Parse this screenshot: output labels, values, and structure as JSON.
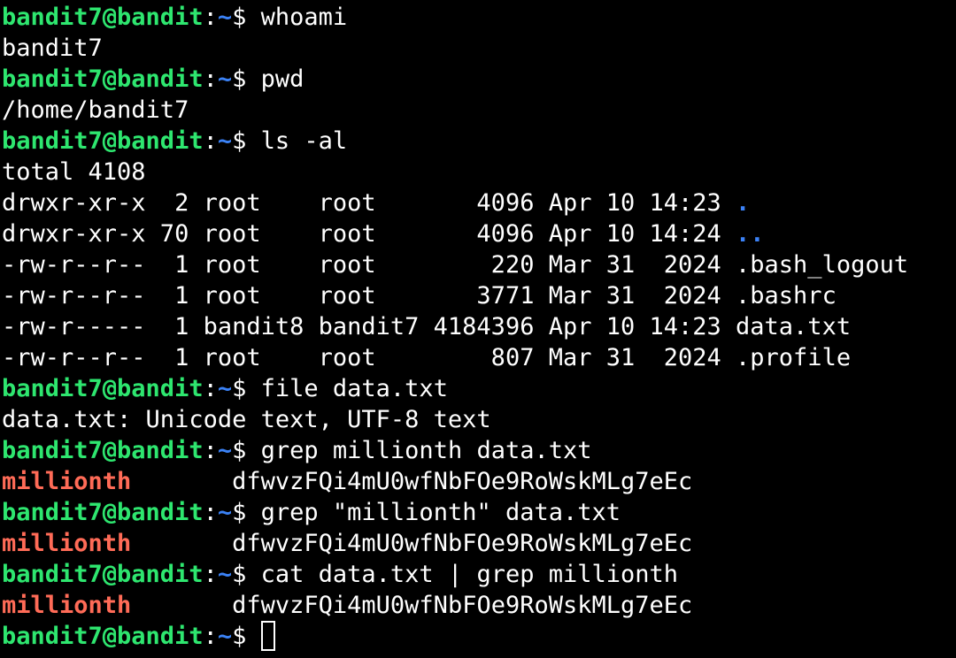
{
  "prompt": {
    "user_host": "bandit7@bandit",
    "colon": ":",
    "path": "~",
    "dollar": "$ "
  },
  "commands": {
    "whoami": "whoami",
    "pwd": "pwd",
    "ls": "ls -al",
    "file": "file data.txt",
    "grep1": "grep millionth data.txt",
    "grep2": "grep \"millionth\" data.txt",
    "cat": "cat data.txt | grep millionth"
  },
  "outputs": {
    "whoami": "bandit7",
    "pwd": "/home/bandit7",
    "total": "total 4108",
    "file": "data.txt: Unicode text, UTF-8 text"
  },
  "ls_rows": [
    {
      "meta": "drwxr-xr-x  2 root    root       4096 Apr 10 14:23 ",
      "name": ".",
      "is_dir": true
    },
    {
      "meta": "drwxr-xr-x 70 root    root       4096 Apr 10 14:24 ",
      "name": "..",
      "is_dir": true
    },
    {
      "meta": "-rw-r--r--  1 root    root        220 Mar 31  2024 ",
      "name": ".bash_logout",
      "is_dir": false
    },
    {
      "meta": "-rw-r--r--  1 root    root       3771 Mar 31  2024 ",
      "name": ".bashrc",
      "is_dir": false
    },
    {
      "meta": "-rw-r-----  1 bandit8 bandit7 4184396 Apr 10 14:23 ",
      "name": "data.txt",
      "is_dir": false
    },
    {
      "meta": "-rw-r--r--  1 root    root        807 Mar 31  2024 ",
      "name": ".profile",
      "is_dir": false
    }
  ],
  "grep_result": {
    "match": "millionth",
    "gap": "       ",
    "value": "dfwvzFQi4mU0wfNbFOe9RoWskMLg7eEc"
  },
  "colors": {
    "background": "#000000",
    "prompt_user": "#2ee66f",
    "prompt_path": "#3b82f6",
    "match": "#ff6b57",
    "directory": "#3b82f6"
  }
}
